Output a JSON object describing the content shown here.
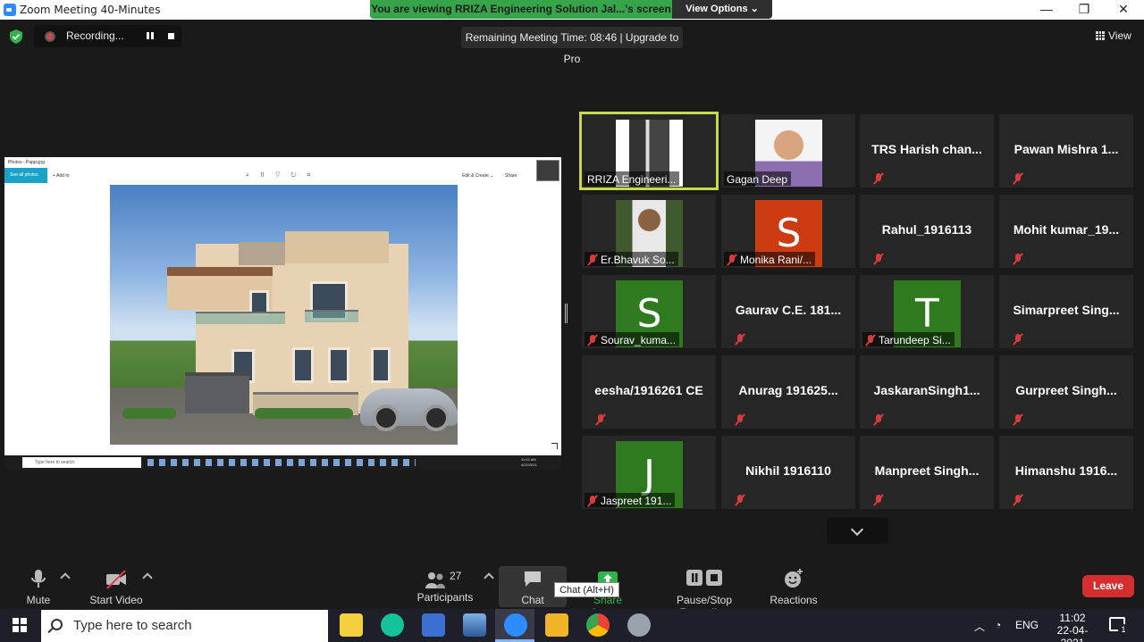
{
  "window": {
    "title": "Zoom Meeting 40-Minutes",
    "minimize": "—",
    "maximize": "❐",
    "close": "✕"
  },
  "banner": {
    "message": "You are viewing RRIZA Engineering Solution Jal...'s screen",
    "view_options": "View Options ⌄"
  },
  "recording": {
    "label": "Recording..."
  },
  "remaining_time": "Remaining Meeting Time: 08:46 | Upgrade to Pro",
  "view_label": "View",
  "shared_screen": {
    "window_title": "Photos - Pappi.jpg",
    "see_all_photos": "See all photos",
    "add_to": "+ Add to",
    "edit_create": "Edit & Create ⌄",
    "share": "Share",
    "taskbar_search": "Type here to search",
    "clock_time": "11:02 AM",
    "clock_date": "4/22/2021"
  },
  "participants_grid": [
    {
      "id": "rriza",
      "label": "RRIZA Engineeri...",
      "type": "photo",
      "active": true,
      "muted": false
    },
    {
      "id": "gagan",
      "label": "Gagan Deep",
      "type": "photo",
      "muted": false
    },
    {
      "id": "trs",
      "center_name": "TRS Harish chan...",
      "type": "name",
      "muted": true
    },
    {
      "id": "pawan",
      "center_name": "Pawan Mishra 1...",
      "type": "name",
      "muted": true
    },
    {
      "id": "bhavuk",
      "label": "Er.Bhavuk So...",
      "type": "photo",
      "muted": true
    },
    {
      "id": "monika",
      "label": "Monika Rani/...",
      "type": "letter",
      "letter": "S",
      "color": "#cc3b12",
      "muted": true
    },
    {
      "id": "rahul",
      "center_name": "Rahul_1916113",
      "type": "name",
      "muted": true
    },
    {
      "id": "mohit",
      "center_name": "Mohit kumar_19...",
      "type": "name",
      "muted": true
    },
    {
      "id": "sourav",
      "label": "Sourav_kuma...",
      "type": "letter",
      "letter": "S",
      "color": "#2f7a1f",
      "muted": true
    },
    {
      "id": "gaurav",
      "center_name": "Gaurav C.E. 181...",
      "type": "name",
      "muted": true
    },
    {
      "id": "tarundeep",
      "label": "Tarundeep Si...",
      "type": "letter",
      "letter": "T",
      "color": "#2f7a1f",
      "muted": true
    },
    {
      "id": "simarpreet",
      "center_name": "Simarpreet Sing...",
      "type": "name",
      "muted": true
    },
    {
      "id": "eesha",
      "center_name": "eesha/1916261 CE",
      "type": "name",
      "muted": true
    },
    {
      "id": "anurag",
      "center_name": "Anurag 191625...",
      "type": "name",
      "muted": true
    },
    {
      "id": "jaskaran",
      "center_name": "JaskaranSingh1...",
      "type": "name",
      "muted": true
    },
    {
      "id": "gurpreet",
      "center_name": "Gurpreet Singh...",
      "type": "name",
      "muted": true
    },
    {
      "id": "jaspreet",
      "label": "Jaspreet 191...",
      "type": "letter",
      "letter": "J",
      "color": "#2f7a1f",
      "muted": true
    },
    {
      "id": "nikhil",
      "center_name": "Nikhil 1916110",
      "type": "name",
      "muted": true
    },
    {
      "id": "manpreet",
      "center_name": "Manpreet Singh...",
      "type": "name",
      "muted": true
    },
    {
      "id": "himanshu",
      "center_name": "Himanshu 1916...",
      "type": "name",
      "muted": true
    }
  ],
  "toolbar": {
    "mute": "Mute",
    "start_video": "Start Video",
    "participants": "Participants",
    "participants_count": "27",
    "chat": "Chat",
    "chat_tooltip": "Chat (Alt+H)",
    "share_screen": "Share Screen",
    "pause_stop_recording": "Pause/Stop Recording",
    "reactions": "Reactions",
    "leave": "Leave"
  },
  "taskbar": {
    "search_placeholder": "Type here to search",
    "language": "ENG",
    "time": "11:02",
    "date": "22-04-2021",
    "notifications": "1"
  },
  "colors": {
    "banner_green": "#36a54a",
    "active_speaker_border": "#c8d84c",
    "leave_red": "#d62e2e",
    "muted_red": "#d83b3b"
  }
}
